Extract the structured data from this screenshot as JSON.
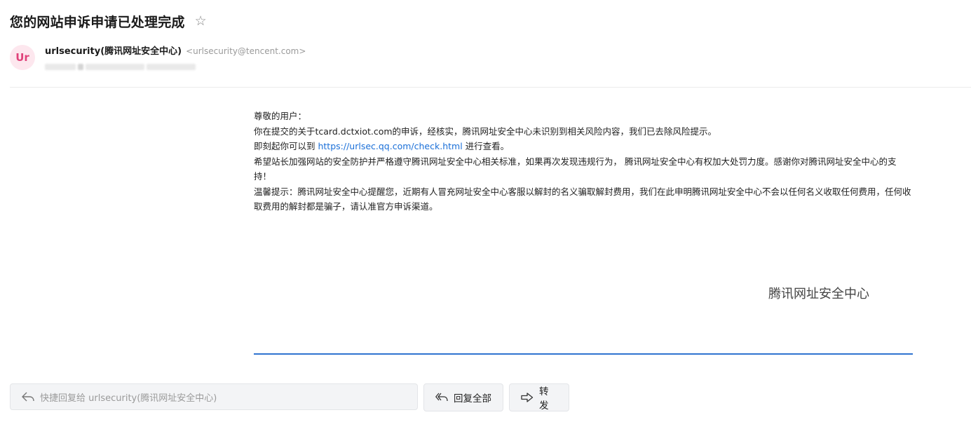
{
  "header": {
    "subject": "您的网站申诉申请已处理完成",
    "star_icon": "star-icon"
  },
  "sender": {
    "avatar_text": "Ur",
    "name": "urlsecurity(腾讯网址安全中心)",
    "email": "<urlsecurity@tencent.com>"
  },
  "body": {
    "greeting": "尊敬的用户：",
    "line1": "你在提交的关于tcard.dctxiot.com的申诉，经核实，腾讯网址安全中心未识别到相关风险内容，我们已去除风险提示。",
    "line2_prefix": "即刻起你可以到 ",
    "line2_link": "https://urlsec.qq.com/check.html",
    "line2_suffix": " 进行查看。",
    "line3": "希望站长加强网站的安全防护并严格遵守腾讯网址安全中心相关标准，如果再次发现违规行为， 腾讯网址安全中心有权加大处罚力度。感谢你对腾讯网址安全中心的支持！",
    "line4": "温馨提示：腾讯网址安全中心提醒您，近期有人冒充网址安全中心客服以解封的名义骗取解封费用，我们在此申明腾讯网址安全中心不会以任何名义收取任何费用，任何收取费用的解封都是骗子，请认准官方申诉渠道。",
    "signature": "腾讯网址安全中心"
  },
  "footer": {
    "quick_reply_placeholder": "快捷回复给 urlsecurity(腾讯网址安全中心)",
    "reply_all_label": "回复全部",
    "forward_label": "转发"
  },
  "colors": {
    "avatar_bg": "#fde7ee",
    "avatar_text": "#e0427a",
    "link": "#1a6fd8",
    "accent_line": "#2f74d0"
  }
}
